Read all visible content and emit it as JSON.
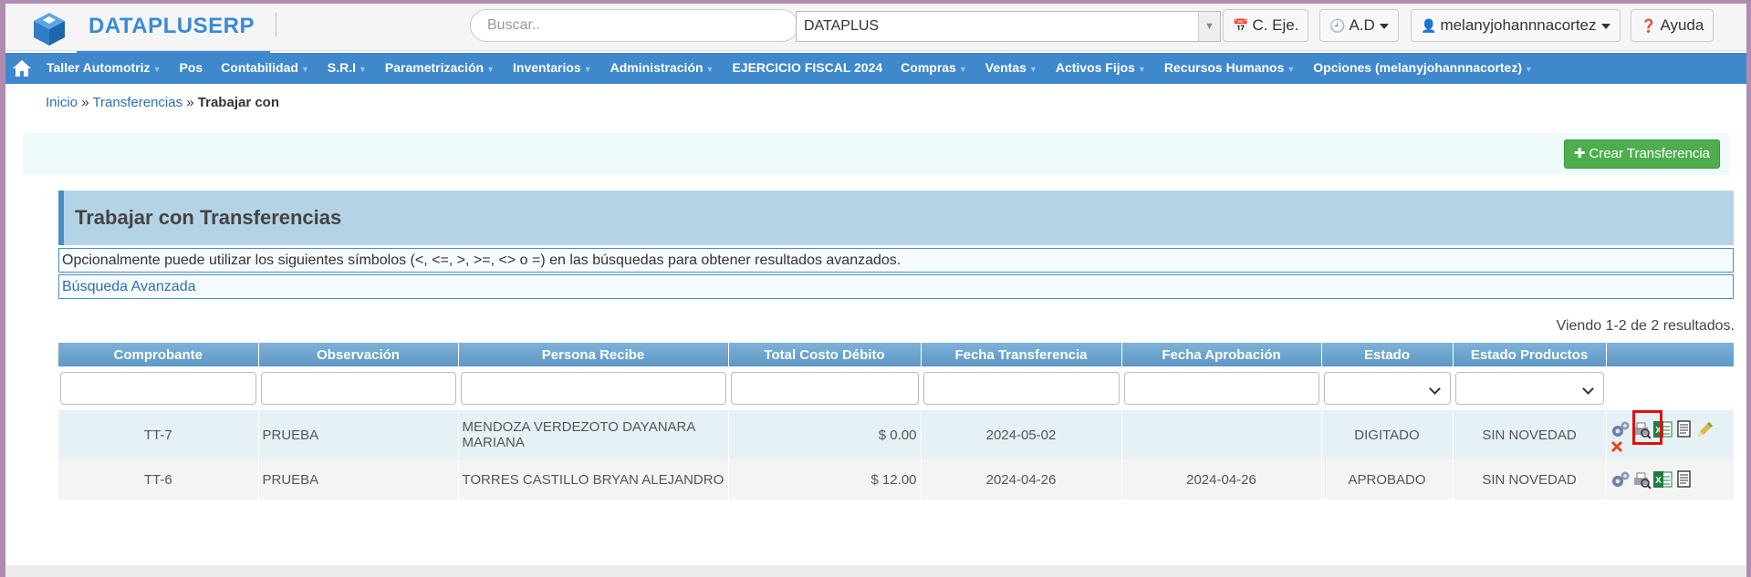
{
  "header": {
    "brand": "DATAPLUSERP",
    "search_placeholder": "Buscar..",
    "company": "DATAPLUS",
    "btn_ejercicio": "C. Eje.",
    "btn_ad": "A.D",
    "btn_user": "melanyjohannnacortez",
    "btn_help": "Ayuda"
  },
  "nav": {
    "items": [
      {
        "label": "Taller Automotriz",
        "dropdown": true
      },
      {
        "label": "Pos",
        "dropdown": false
      },
      {
        "label": "Contabilidad",
        "dropdown": true
      },
      {
        "label": "S.R.I",
        "dropdown": true
      },
      {
        "label": "Parametrización",
        "dropdown": true
      },
      {
        "label": "Inventarios",
        "dropdown": true
      },
      {
        "label": "Administración",
        "dropdown": true
      },
      {
        "label": "EJERCICIO FISCAL 2024",
        "dropdown": false
      },
      {
        "label": "Compras",
        "dropdown": true
      },
      {
        "label": "Ventas",
        "dropdown": true
      },
      {
        "label": "Activos Fijos",
        "dropdown": true
      },
      {
        "label": "Recursos Humanos",
        "dropdown": true
      },
      {
        "label": "Opciones (melanyjohannnacortez)",
        "dropdown": true
      }
    ]
  },
  "breadcrumb": {
    "home": "Inicio",
    "sep": "»",
    "section": "Transferencias",
    "current": "Trabajar con"
  },
  "toolbar": {
    "create_label": "Crear Transferencia"
  },
  "panel": {
    "title": "Trabajar con Transferencias",
    "hint": "Opcionalmente puede utilizar los siguientes símbolos (<, <=, >, >=, <> o =) en las búsquedas para obtener resultados avanzados.",
    "advanced": "Búsqueda Avanzada",
    "summary": "Viendo 1-2 de 2 resultados."
  },
  "table": {
    "columns": [
      "Comprobante",
      "Observación",
      "Persona Recibe",
      "Total Costo Débito",
      "Fecha Transferencia",
      "Fecha Aprobación",
      "Estado",
      "Estado Productos",
      ""
    ],
    "rows": [
      {
        "comprobante": "TT-7",
        "observacion": "PRUEBA",
        "persona": "MENDOZA VERDEZOTO DAYANARA MARIANA",
        "total": "$ 0.00",
        "fecha_transf": "2024-05-02",
        "fecha_aprob": "",
        "estado": "DIGITADO",
        "estado_prod": "SIN NOVEDAD"
      },
      {
        "comprobante": "TT-6",
        "observacion": "PRUEBA",
        "persona": "TORRES CASTILLO BRYAN ALEJANDRO",
        "total": "$ 12.00",
        "fecha_transf": "2024-04-26",
        "fecha_aprob": "2024-04-26",
        "estado": "APROBADO",
        "estado_prod": "SIN NOVEDAD"
      }
    ]
  },
  "colors": {
    "brand": "#3a8ad6",
    "nav": "#3f88cc",
    "create": "#4eae4e",
    "highlight": "#e01010"
  }
}
